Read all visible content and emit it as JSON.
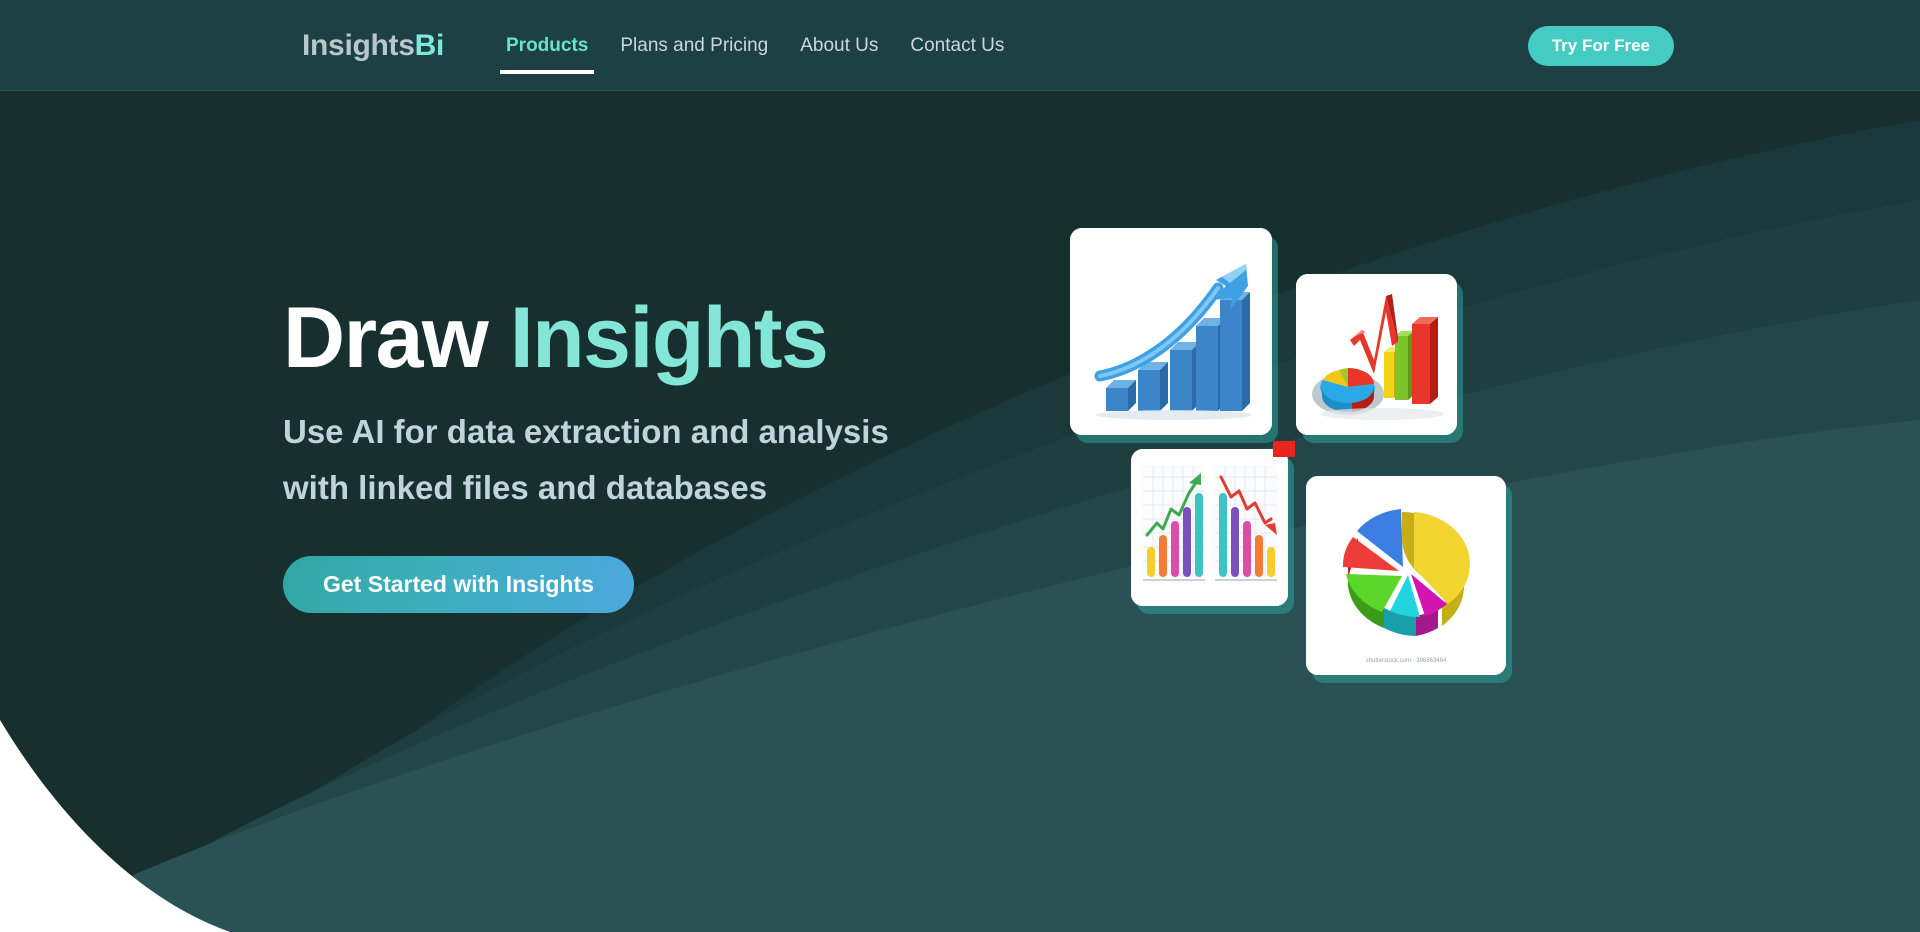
{
  "header": {
    "brand": {
      "primary": "Insights",
      "accent": "Bi"
    },
    "nav": [
      {
        "label": "Products",
        "active": true
      },
      {
        "label": "Plans and Pricing",
        "active": false
      },
      {
        "label": "About Us",
        "active": false
      },
      {
        "label": "Contact Us",
        "active": false
      }
    ],
    "cta_label": "Try For Free"
  },
  "hero": {
    "title_plain": "Draw",
    "title_accent": "Insights",
    "subtitle_line1": "Use AI for data extraction and analysis",
    "subtitle_line2": "with linked files and databases",
    "cta_label": "Get Started with Insights"
  },
  "collage": {
    "cards": [
      {
        "name": "growth-bar-chart",
        "alt": "3D blue ascending bar chart with upward arrow"
      },
      {
        "name": "mixed-3d-charts",
        "alt": "3D red and green bars with pie chart and red line"
      },
      {
        "name": "dual-trend-charts",
        "alt": "Two grid panels of colorful bars with green up arrow and red down line"
      },
      {
        "name": "exploded-pie-chart",
        "alt": "3D exploded pie chart with six colored slices"
      }
    ],
    "watermark": "shutterstock.com · 396863464"
  },
  "colors": {
    "page_bg": "#17302F",
    "header_bg": "#1D4044",
    "accent_teal": "#46CBC2",
    "accent_mint": "#83E6D6",
    "nav_active": "#68E3C4",
    "text_muted": "#C2D3DB",
    "cta_gradient_start": "#32A6A4",
    "cta_gradient_end": "#4CA8DC",
    "arc_light": "#2B5052",
    "arc_mid": "#214245",
    "arc_dark": "#1B383A"
  }
}
